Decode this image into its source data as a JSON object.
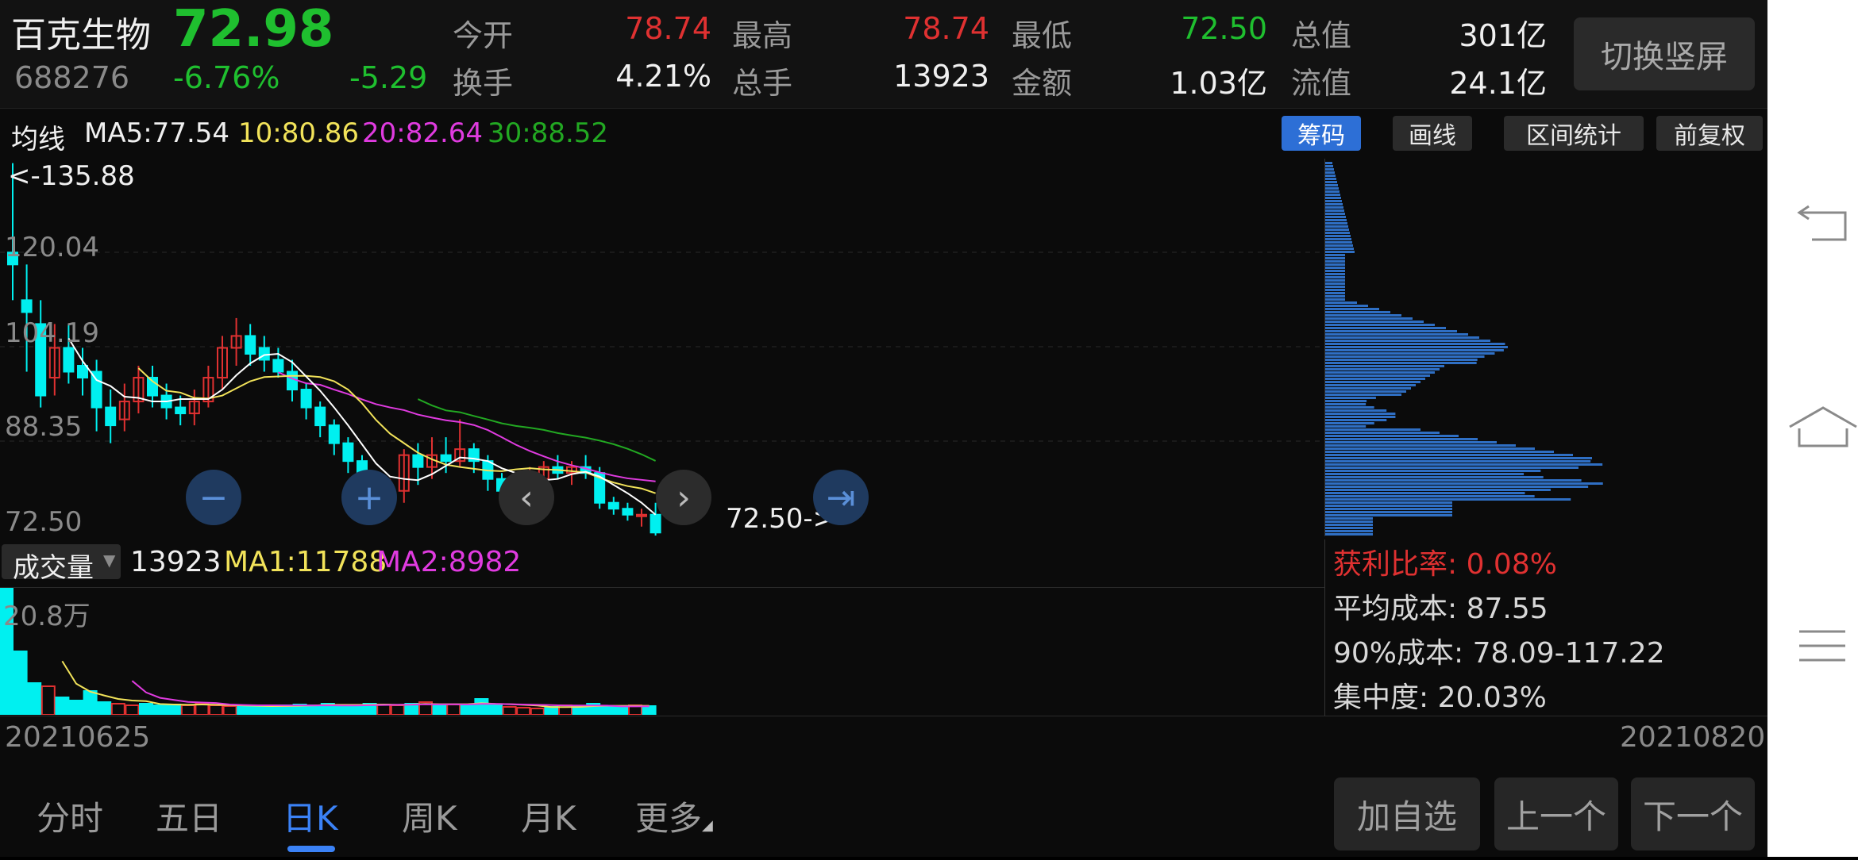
{
  "stock": {
    "name": "百克生物",
    "code": "688276",
    "price": "72.98",
    "change_pct": "-6.76%",
    "change": "-5.29"
  },
  "stats": {
    "open_label": "今开",
    "open": "78.74",
    "high_label": "最高",
    "high": "78.74",
    "low_label": "最低",
    "low": "72.50",
    "mktcap_label": "总值",
    "mktcap": "301亿",
    "turnover_label": "换手",
    "turnover": "4.21%",
    "volume_label": "总手",
    "volume": "13923",
    "amount_label": "金额",
    "amount": "1.03亿",
    "float_label": "流值",
    "float": "24.1亿"
  },
  "switch_label": "切换竖屏",
  "ma": {
    "label": "均线",
    "ma5": "MA5:77.54",
    "ma10": "10:80.86",
    "ma20": "20:82.64",
    "ma30": "30:88.52"
  },
  "tools": {
    "chips": "筹码",
    "draw": "画线",
    "range": "区间统计",
    "adjust": "前复权"
  },
  "price_axis": {
    "high_marker": "<-135.88",
    "t120": "120.04",
    "t104": "104.19",
    "t88": "88.35",
    "t72": "72.50",
    "low_marker": "72.50->"
  },
  "volume": {
    "selector": "成交量",
    "value": "13923",
    "ma1": "MA1:11788",
    "ma2": "MA2:8982",
    "max_tick": "20.8万"
  },
  "chip_stats": {
    "profit": "获利比率: 0.08%",
    "avg_cost": "平均成本: 87.55",
    "cost90": "90%成本:  78.09-117.22",
    "concentration": "集中度: 20.03%"
  },
  "dates": {
    "start": "20210625",
    "end": "20210820"
  },
  "tabs": [
    "分时",
    "五日",
    "日K",
    "周K",
    "月K",
    "更多"
  ],
  "buttons": {
    "add": "加自选",
    "prev": "上一个",
    "next": "下一个"
  },
  "colors": {
    "up": "#e03131",
    "down": "#00f0f0",
    "ma5": "#ffffff",
    "ma10": "#f2e35a",
    "ma20": "#e03be0",
    "ma30": "#22a822",
    "accent": "#3b82f6"
  }
}
